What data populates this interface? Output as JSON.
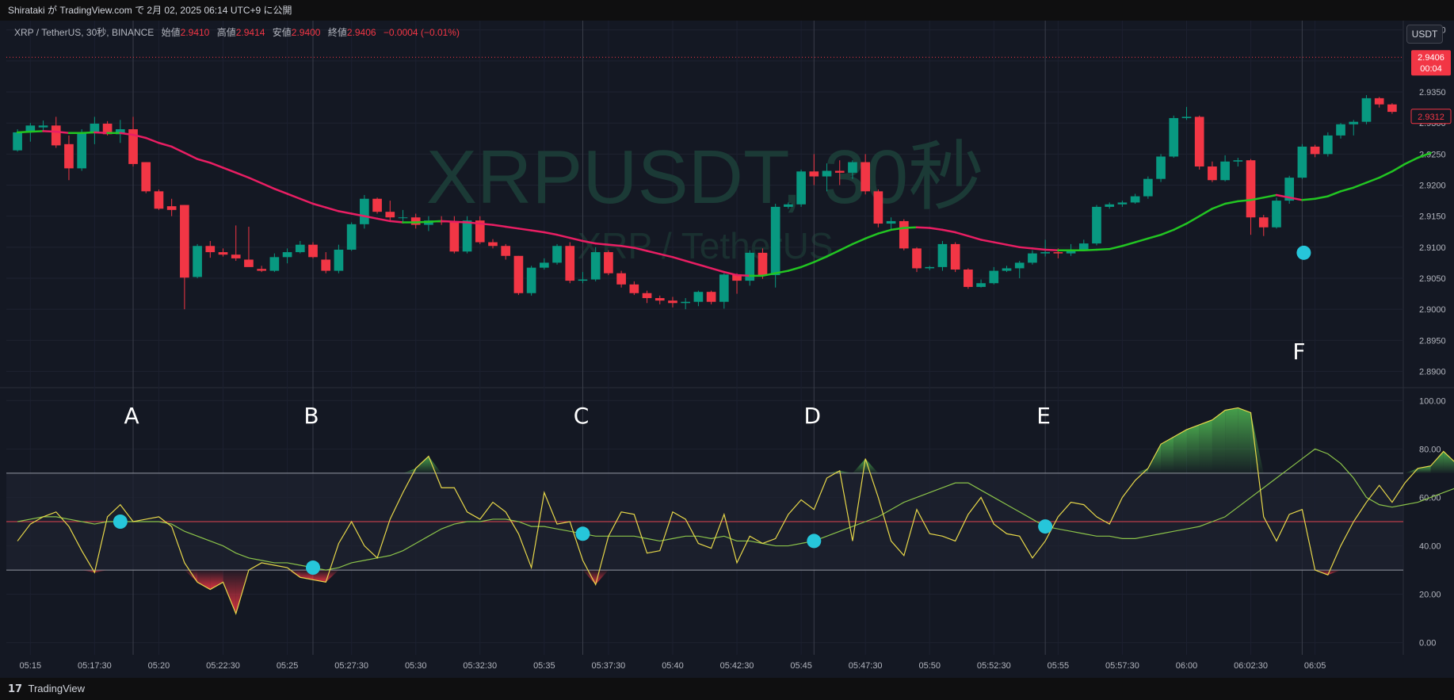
{
  "header": {
    "published_text": "Shirataki が TradingView.com で 2月 02, 2025 06:14 UTC+9 に公開"
  },
  "legend": {
    "symbol": "XRP / TetherUS, 30秒, BINANCE",
    "open_label": "始値",
    "open_value": "2.9410",
    "high_label": "高値",
    "high_value": "2.9414",
    "low_label": "安値",
    "low_value": "2.9400",
    "close_label": "終値",
    "close_value": "2.9406",
    "change": "−0.0004 (−0.01%)"
  },
  "currency_badge": "USDT",
  "watermark": {
    "main": "XRPUSDT, 30秒",
    "sub": "XRP / TetherUS"
  },
  "footer": {
    "brand": "TradingView"
  },
  "colors": {
    "up": "#089981",
    "down": "#f23645",
    "ma_up": "#22c522",
    "ma_down": "#e91e63",
    "rsi": "#e8d84a",
    "rsi_ma": "#8bc34a",
    "signal": "#26c6da"
  },
  "chart_data": [
    {
      "type": "candlestick",
      "title": "XRP / TetherUS, 30秒, BINANCE",
      "ylim": [
        2.8875,
        2.9465
      ],
      "y_ticks": [
        "2.9450",
        "2.9400",
        "2.9350",
        "2.9300",
        "2.9250",
        "2.9200",
        "2.9150",
        "2.9100",
        "2.9050",
        "2.9000",
        "2.8950",
        "2.8900"
      ],
      "x_ticks": [
        "05:15",
        "05:17:30",
        "05:20",
        "05:22:30",
        "05:25",
        "05:27:30",
        "05:30",
        "05:32:30",
        "05:35",
        "05:37:30",
        "05:40",
        "05:42:30",
        "05:45",
        "05:47:30",
        "05:50",
        "05:52:30",
        "05:55",
        "05:57:30",
        "06:00",
        "06:02:30",
        "06:05"
      ],
      "last_price": "2.9406",
      "countdown": "00:04",
      "ma_value": "2.9312",
      "markers": [
        "A",
        "B",
        "C",
        "D",
        "E",
        "F"
      ],
      "candles": [
        {
          "o": 2.9256,
          "h": 2.929,
          "l": 2.9254,
          "c": 2.9285
        },
        {
          "o": 2.9285,
          "h": 2.93,
          "l": 2.927,
          "c": 2.9296
        },
        {
          "o": 2.9293,
          "h": 2.9304,
          "l": 2.9287,
          "c": 2.9296
        },
        {
          "o": 2.9296,
          "h": 2.931,
          "l": 2.926,
          "c": 2.9264
        },
        {
          "o": 2.9266,
          "h": 2.928,
          "l": 2.9208,
          "c": 2.9227
        },
        {
          "o": 2.9227,
          "h": 2.929,
          "l": 2.9223,
          "c": 2.9285
        },
        {
          "o": 2.9285,
          "h": 2.931,
          "l": 2.9266,
          "c": 2.9299
        },
        {
          "o": 2.9299,
          "h": 2.9303,
          "l": 2.928,
          "c": 2.9282
        },
        {
          "o": 2.9282,
          "h": 2.9305,
          "l": 2.9268,
          "c": 2.929
        },
        {
          "o": 2.929,
          "h": 2.931,
          "l": 2.923,
          "c": 2.9234
        },
        {
          "o": 2.9237,
          "h": 2.9237,
          "l": 2.9187,
          "c": 2.919
        },
        {
          "o": 2.919,
          "h": 2.9193,
          "l": 2.916,
          "c": 2.9162
        },
        {
          "o": 2.9166,
          "h": 2.9178,
          "l": 2.915,
          "c": 2.916
        },
        {
          "o": 2.9168,
          "h": 2.9168,
          "l": 2.9,
          "c": 2.9051
        },
        {
          "o": 2.9052,
          "h": 2.9105,
          "l": 2.905,
          "c": 2.9102
        },
        {
          "o": 2.9102,
          "h": 2.911,
          "l": 2.9083,
          "c": 2.9092
        },
        {
          "o": 2.9092,
          "h": 2.9098,
          "l": 2.9085,
          "c": 2.9088
        },
        {
          "o": 2.9088,
          "h": 2.9135,
          "l": 2.9078,
          "c": 2.9082
        },
        {
          "o": 2.908,
          "h": 2.9133,
          "l": 2.907,
          "c": 2.9068
        },
        {
          "o": 2.9065,
          "h": 2.907,
          "l": 2.906,
          "c": 2.9062
        },
        {
          "o": 2.9062,
          "h": 2.909,
          "l": 2.906,
          "c": 2.9084
        },
        {
          "o": 2.9084,
          "h": 2.9098,
          "l": 2.9074,
          "c": 2.9092
        },
        {
          "o": 2.9092,
          "h": 2.911,
          "l": 2.909,
          "c": 2.9104
        },
        {
          "o": 2.9104,
          "h": 2.9108,
          "l": 2.9082,
          "c": 2.9084
        },
        {
          "o": 2.908,
          "h": 2.9092,
          "l": 2.9058,
          "c": 2.9062
        },
        {
          "o": 2.9062,
          "h": 2.9104,
          "l": 2.9058,
          "c": 2.9096
        },
        {
          "o": 2.9096,
          "h": 2.914,
          "l": 2.9094,
          "c": 2.9137
        },
        {
          "o": 2.9137,
          "h": 2.9184,
          "l": 2.913,
          "c": 2.9178
        },
        {
          "o": 2.9178,
          "h": 2.918,
          "l": 2.9154,
          "c": 2.9157
        },
        {
          "o": 2.9157,
          "h": 2.9175,
          "l": 2.9142,
          "c": 2.9148
        },
        {
          "o": 2.9148,
          "h": 2.916,
          "l": 2.9138,
          "c": 2.9148
        },
        {
          "o": 2.9148,
          "h": 2.9154,
          "l": 2.913,
          "c": 2.9136
        },
        {
          "o": 2.9136,
          "h": 2.915,
          "l": 2.9126,
          "c": 2.9143
        },
        {
          "o": 2.9143,
          "h": 2.915,
          "l": 2.9136,
          "c": 2.914
        },
        {
          "o": 2.914,
          "h": 2.915,
          "l": 2.909,
          "c": 2.9093
        },
        {
          "o": 2.9093,
          "h": 2.915,
          "l": 2.909,
          "c": 2.9143
        },
        {
          "o": 2.9143,
          "h": 2.915,
          "l": 2.9105,
          "c": 2.9108
        },
        {
          "o": 2.9108,
          "h": 2.9113,
          "l": 2.9098,
          "c": 2.9102
        },
        {
          "o": 2.9102,
          "h": 2.9105,
          "l": 2.908,
          "c": 2.9086
        },
        {
          "o": 2.9086,
          "h": 2.9086,
          "l": 2.9023,
          "c": 2.9026
        },
        {
          "o": 2.9026,
          "h": 2.907,
          "l": 2.9022,
          "c": 2.9067
        },
        {
          "o": 2.9067,
          "h": 2.9082,
          "l": 2.9064,
          "c": 2.9075
        },
        {
          "o": 2.9075,
          "h": 2.9105,
          "l": 2.9072,
          "c": 2.9102
        },
        {
          "o": 2.9102,
          "h": 2.9108,
          "l": 2.9042,
          "c": 2.9046
        },
        {
          "o": 2.9046,
          "h": 2.906,
          "l": 2.9042,
          "c": 2.9048
        },
        {
          "o": 2.9048,
          "h": 2.91,
          "l": 2.9045,
          "c": 2.9092
        },
        {
          "o": 2.9092,
          "h": 2.9095,
          "l": 2.9055,
          "c": 2.9058
        },
        {
          "o": 2.9058,
          "h": 2.9062,
          "l": 2.9035,
          "c": 2.904
        },
        {
          "o": 2.904,
          "h": 2.9045,
          "l": 2.9023,
          "c": 2.9026
        },
        {
          "o": 2.9026,
          "h": 2.903,
          "l": 2.901,
          "c": 2.9018
        },
        {
          "o": 2.9018,
          "h": 2.9022,
          "l": 2.9008,
          "c": 2.9014
        },
        {
          "o": 2.9014,
          "h": 2.902,
          "l": 2.9003,
          "c": 2.901
        },
        {
          "o": 2.901,
          "h": 2.9018,
          "l": 2.9,
          "c": 2.9012
        },
        {
          "o": 2.9012,
          "h": 2.903,
          "l": 2.9005,
          "c": 2.9028
        },
        {
          "o": 2.9028,
          "h": 2.903,
          "l": 2.9008,
          "c": 2.9012
        },
        {
          "o": 2.9012,
          "h": 2.9058,
          "l": 2.9001,
          "c": 2.9056
        },
        {
          "o": 2.9056,
          "h": 2.9058,
          "l": 2.9025,
          "c": 2.9046
        },
        {
          "o": 2.9046,
          "h": 2.9095,
          "l": 2.9038,
          "c": 2.9091
        },
        {
          "o": 2.9091,
          "h": 2.9098,
          "l": 2.9049,
          "c": 2.9055
        },
        {
          "o": 2.9055,
          "h": 2.917,
          "l": 2.9035,
          "c": 2.9165
        },
        {
          "o": 2.9165,
          "h": 2.9172,
          "l": 2.9162,
          "c": 2.9169
        },
        {
          "o": 2.9169,
          "h": 2.9225,
          "l": 2.9165,
          "c": 2.9222
        },
        {
          "o": 2.9222,
          "h": 2.925,
          "l": 2.92,
          "c": 2.9214
        },
        {
          "o": 2.9214,
          "h": 2.9235,
          "l": 2.919,
          "c": 2.9223
        },
        {
          "o": 2.9223,
          "h": 2.924,
          "l": 2.92,
          "c": 2.922
        },
        {
          "o": 2.922,
          "h": 2.924,
          "l": 2.921,
          "c": 2.9237
        },
        {
          "o": 2.9237,
          "h": 2.925,
          "l": 2.9185,
          "c": 2.919
        },
        {
          "o": 2.919,
          "h": 2.9193,
          "l": 2.9132,
          "c": 2.9138
        },
        {
          "o": 2.9138,
          "h": 2.9148,
          "l": 2.9128,
          "c": 2.9142
        },
        {
          "o": 2.9142,
          "h": 2.9145,
          "l": 2.9095,
          "c": 2.9098
        },
        {
          "o": 2.9098,
          "h": 2.91,
          "l": 2.906,
          "c": 2.9066
        },
        {
          "o": 2.9066,
          "h": 2.907,
          "l": 2.9063,
          "c": 2.9068
        },
        {
          "o": 2.9068,
          "h": 2.911,
          "l": 2.9062,
          "c": 2.9105
        },
        {
          "o": 2.9105,
          "h": 2.9108,
          "l": 2.906,
          "c": 2.9064
        },
        {
          "o": 2.9064,
          "h": 2.9066,
          "l": 2.9033,
          "c": 2.9036
        },
        {
          "o": 2.9036,
          "h": 2.9048,
          "l": 2.9035,
          "c": 2.9042
        },
        {
          "o": 2.9042,
          "h": 2.9068,
          "l": 2.904,
          "c": 2.9062
        },
        {
          "o": 2.9062,
          "h": 2.907,
          "l": 2.906,
          "c": 2.9066
        },
        {
          "o": 2.9066,
          "h": 2.9078,
          "l": 2.905,
          "c": 2.9075
        },
        {
          "o": 2.9075,
          "h": 2.9095,
          "l": 2.9072,
          "c": 2.909
        },
        {
          "o": 2.909,
          "h": 2.9112,
          "l": 2.9085,
          "c": 2.9092
        },
        {
          "o": 2.9092,
          "h": 2.9098,
          "l": 2.9082,
          "c": 2.909
        },
        {
          "o": 2.909,
          "h": 2.9105,
          "l": 2.9086,
          "c": 2.9096
        },
        {
          "o": 2.9096,
          "h": 2.9112,
          "l": 2.9094,
          "c": 2.9106
        },
        {
          "o": 2.9106,
          "h": 2.9168,
          "l": 2.9103,
          "c": 2.9165
        },
        {
          "o": 2.9165,
          "h": 2.9172,
          "l": 2.9162,
          "c": 2.9169
        },
        {
          "o": 2.9169,
          "h": 2.9175,
          "l": 2.9165,
          "c": 2.9172
        },
        {
          "o": 2.9172,
          "h": 2.9186,
          "l": 2.917,
          "c": 2.9182
        },
        {
          "o": 2.9182,
          "h": 2.9214,
          "l": 2.9178,
          "c": 2.921
        },
        {
          "o": 2.921,
          "h": 2.925,
          "l": 2.9205,
          "c": 2.9246
        },
        {
          "o": 2.9246,
          "h": 2.9312,
          "l": 2.9244,
          "c": 2.9308
        },
        {
          "o": 2.9308,
          "h": 2.9326,
          "l": 2.9305,
          "c": 2.931
        },
        {
          "o": 2.931,
          "h": 2.9312,
          "l": 2.9225,
          "c": 2.923
        },
        {
          "o": 2.923,
          "h": 2.9238,
          "l": 2.9205,
          "c": 2.9208
        },
        {
          "o": 2.9208,
          "h": 2.9248,
          "l": 2.9206,
          "c": 2.9238
        },
        {
          "o": 2.9238,
          "h": 2.9244,
          "l": 2.923,
          "c": 2.924
        },
        {
          "o": 2.924,
          "h": 2.9242,
          "l": 2.912,
          "c": 2.9148
        },
        {
          "o": 2.9148,
          "h": 2.9152,
          "l": 2.9118,
          "c": 2.9132
        },
        {
          "o": 2.9132,
          "h": 2.918,
          "l": 2.913,
          "c": 2.9175
        },
        {
          "o": 2.9175,
          "h": 2.9215,
          "l": 2.917,
          "c": 2.9212
        },
        {
          "o": 2.9212,
          "h": 2.9266,
          "l": 2.921,
          "c": 2.9262
        },
        {
          "o": 2.9262,
          "h": 2.9265,
          "l": 2.9245,
          "c": 2.925
        },
        {
          "o": 2.925,
          "h": 2.9285,
          "l": 2.9246,
          "c": 2.928
        },
        {
          "o": 2.928,
          "h": 2.93,
          "l": 2.9275,
          "c": 2.9298
        },
        {
          "o": 2.9298,
          "h": 2.9305,
          "l": 2.928,
          "c": 2.9302
        },
        {
          "o": 2.9302,
          "h": 2.9345,
          "l": 2.9298,
          "c": 2.934
        },
        {
          "o": 2.934,
          "h": 2.9342,
          "l": 2.9325,
          "c": 2.933
        },
        {
          "o": 2.933,
          "h": 2.9332,
          "l": 2.9315,
          "c": 2.9318
        }
      ],
      "ma": [
        2.9285,
        2.9286,
        2.9287,
        2.9286,
        2.9284,
        2.9284,
        2.9285,
        2.9284,
        2.9284,
        2.9281,
        2.9276,
        2.9268,
        2.9262,
        2.9252,
        2.9242,
        2.9236,
        2.9228,
        2.922,
        2.9212,
        2.9203,
        2.9194,
        2.9186,
        2.9178,
        2.917,
        2.9164,
        2.9158,
        2.9154,
        2.915,
        2.9146,
        2.9142,
        2.914,
        2.914,
        2.9141,
        2.9142,
        2.9141,
        2.914,
        2.9138,
        2.9136,
        2.9133,
        2.913,
        2.9127,
        2.9124,
        2.912,
        2.9115,
        2.911,
        2.9106,
        2.9104,
        2.9102,
        2.9099,
        2.9094,
        2.9089,
        2.9084,
        2.9078,
        2.9072,
        2.9066,
        2.906,
        2.9055,
        2.9054,
        2.9054,
        2.9058,
        2.9062,
        2.9068,
        2.9076,
        2.9085,
        2.9095,
        2.9105,
        2.9114,
        2.9122,
        2.9128,
        2.9131,
        2.9132,
        2.9131,
        2.9128,
        2.9124,
        2.9118,
        2.9112,
        2.9108,
        2.9104,
        2.91,
        2.9098,
        2.9096,
        2.9095,
        2.9095,
        2.9095,
        2.9096,
        2.9097,
        2.9102,
        2.9108,
        2.9114,
        2.912,
        2.9128,
        2.9138,
        2.915,
        2.9162,
        2.917,
        2.9174,
        2.9176,
        2.918,
        2.9184,
        2.918,
        2.9176,
        2.9178,
        2.9182,
        2.919,
        2.9196,
        2.9204,
        2.9212,
        2.9222,
        2.9234,
        2.9244,
        2.9252
      ]
    },
    {
      "type": "line",
      "title": "RSI",
      "ylim": [
        -5,
        105
      ],
      "y_ticks": [
        "100.00",
        "80.00",
        "60.00",
        "40.00",
        "20.00",
        "0.00"
      ],
      "bands": {
        "upper": 70,
        "middle": 50,
        "lower": 30
      },
      "series": [
        {
          "values": [
            42,
            49,
            52,
            54,
            48,
            38,
            29,
            52,
            57,
            50,
            51,
            52,
            48,
            33,
            25,
            22,
            25,
            12,
            30,
            33,
            32,
            31,
            27,
            26,
            25,
            41,
            50,
            40,
            35,
            51,
            62,
            72,
            77,
            64,
            64,
            54,
            51,
            58,
            54,
            45,
            31,
            62,
            49,
            50,
            34,
            24,
            44,
            54,
            53,
            37,
            38,
            54,
            51,
            41,
            39,
            53,
            33,
            44,
            41,
            43,
            53,
            59,
            55,
            68,
            71,
            42,
            76,
            60,
            42,
            36,
            55,
            45,
            44,
            42,
            53,
            60,
            49,
            45,
            44,
            35,
            42,
            52,
            58,
            57,
            52,
            49,
            60,
            67,
            72,
            82,
            85,
            88,
            90,
            92,
            96,
            97,
            95,
            52,
            42,
            53,
            55,
            30,
            28,
            40,
            50,
            58,
            65,
            58,
            66,
            72,
            73,
            79,
            74,
            64
          ]
        },
        {
          "values": [
            50,
            51,
            52,
            52,
            51,
            50,
            49,
            50,
            50,
            50,
            50,
            50,
            49,
            46,
            44,
            42,
            40,
            37,
            35,
            34,
            33,
            33,
            32,
            31,
            30,
            31,
            33,
            34,
            35,
            36,
            38,
            41,
            44,
            47,
            49,
            50,
            50,
            51,
            51,
            50,
            48,
            48,
            47,
            46,
            45,
            44,
            44,
            44,
            44,
            43,
            42,
            43,
            44,
            44,
            43,
            44,
            42,
            42,
            41,
            40,
            40,
            41,
            42,
            44,
            46,
            48,
            50,
            52,
            55,
            58,
            60,
            62,
            64,
            66,
            66,
            63,
            60,
            57,
            54,
            51,
            48,
            47,
            46,
            45,
            44,
            44,
            43,
            43,
            44,
            45,
            46,
            47,
            48,
            50,
            52,
            56,
            60,
            64,
            68,
            72,
            76,
            80,
            78,
            74,
            68,
            60,
            57,
            56,
            57,
            58,
            60,
            62,
            64,
            66,
            67
          ]
        }
      ],
      "signals": [
        "A",
        "B",
        "C",
        "D",
        "E"
      ]
    }
  ]
}
